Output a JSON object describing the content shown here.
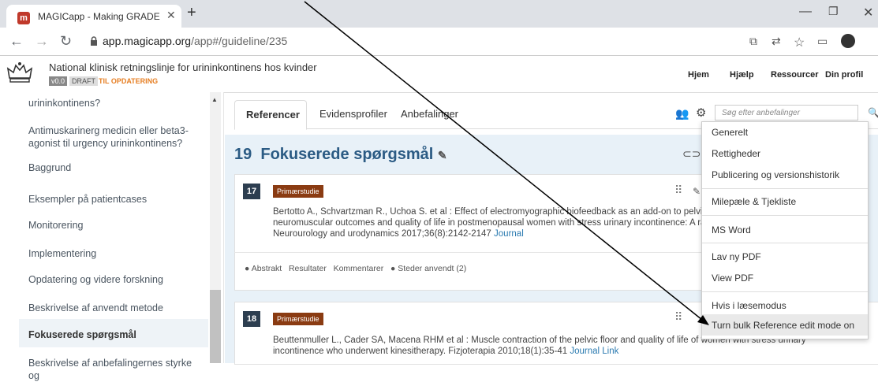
{
  "browser": {
    "tab_title": "MAGICapp - Making GRADE the",
    "favicon_letter": "m",
    "url_host": "app.magicapp.org",
    "url_path": "/app#/guideline/235"
  },
  "header": {
    "guideline_title": "National klinisk retningslinje for urininkontinens hos kvinder",
    "version": "v0.0",
    "draft": "DRAFT",
    "status": "TIL OPDATERING",
    "nav": [
      "Hjem",
      "Hjælp",
      "Ressourcer",
      "Din profil"
    ]
  },
  "sidebar": {
    "items": [
      "urininkontinens?",
      "Antimuskarinerg medicin eller beta3-agonist til urgency urininkontinens?",
      "Baggrund",
      "Eksempler på patientcases",
      "Monitorering",
      "Implementering",
      "Opdatering og videre forskning",
      "Beskrivelse af anvendt metode",
      "Fokuserede spørgsmål",
      "Beskrivelse af anbefalingernes styrke og"
    ]
  },
  "main": {
    "tabs": [
      "Referencer",
      "Evidensprofiler",
      "Anbefalinger"
    ],
    "search_placeholder": "Søg efter anbefalinger",
    "heading_count": "19",
    "heading_text": "Fokuserede spørgsmål"
  },
  "refs": [
    {
      "number": "17",
      "tag": "Primærstudie",
      "line1": "Bertotto A., Schvartzman R., Uchoa S. et al : Effect of electromyographic biofeedback as an add-on to pelvi",
      "line2": "neuromuscular outcomes and quality of life in postmenopausal women with stress urinary incontinence: A ra",
      "line3": "Neurourology and urodynamics 2017;36(8):2142-2147",
      "link": "Journal",
      "tabs": [
        "Abstrakt",
        "Resultater",
        "Kommentarer",
        "Steder anvendt (2)"
      ]
    },
    {
      "number": "18",
      "tag": "Primærstudie",
      "line1": "Beuttenmuller L., Cader SA, Macena RHM et al : Muscle contraction of the pelvic floor and quality of life of women with stress urinary",
      "line2": "incontinence who underwent kinesitherapy. Fizjoterapia 2010;18(1):35-41",
      "link": "Journal Link"
    }
  ],
  "menu": {
    "items": [
      "Generelt",
      "Rettigheder",
      "Publicering og versionshistorik",
      "Milepæle & Tjekliste",
      "MS Word",
      "Lav ny PDF",
      "View PDF",
      "Hvis i læsemodus",
      "Turn bulk Reference edit mode on"
    ]
  }
}
